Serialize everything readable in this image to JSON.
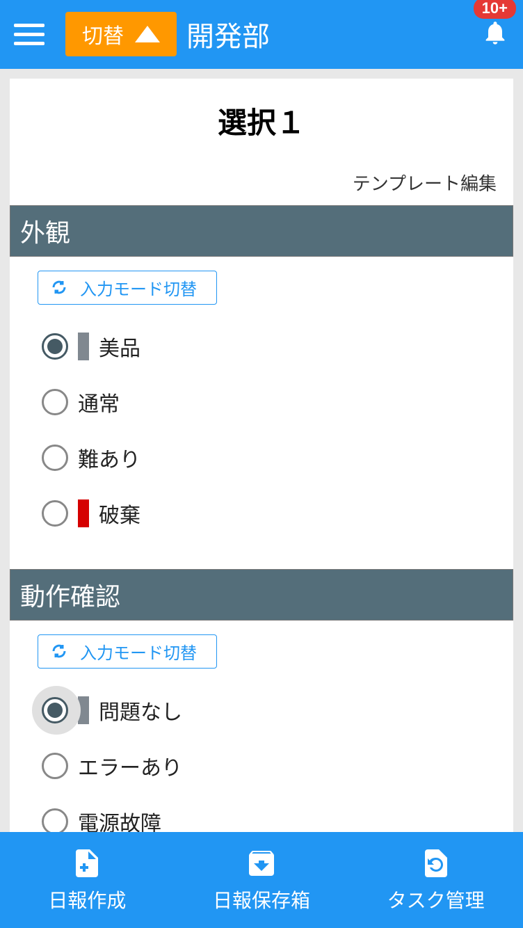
{
  "header": {
    "switch_label": "切替",
    "title": "開発部",
    "badge": "10+"
  },
  "page": {
    "title": "選択１",
    "template_edit": "テンプレート編集"
  },
  "sections": [
    {
      "title": "外観",
      "mode_toggle": "入力モード切替",
      "options": [
        {
          "label": "美品",
          "selected": true,
          "color": "#808890",
          "focus": false
        },
        {
          "label": "通常",
          "selected": false,
          "color": null,
          "focus": false
        },
        {
          "label": "難あり",
          "selected": false,
          "color": null,
          "focus": false
        },
        {
          "label": "破棄",
          "selected": false,
          "color": "#d50000",
          "focus": false
        }
      ]
    },
    {
      "title": "動作確認",
      "mode_toggle": "入力モード切替",
      "options": [
        {
          "label": "問題なし",
          "selected": true,
          "color": "#808890",
          "focus": true
        },
        {
          "label": "エラーあり",
          "selected": false,
          "color": null,
          "focus": false
        },
        {
          "label": "電源故障",
          "selected": false,
          "color": null,
          "focus": false
        }
      ]
    }
  ],
  "bottom_nav": {
    "items": [
      {
        "label": "日報作成"
      },
      {
        "label": "日報保存箱"
      },
      {
        "label": "タスク管理"
      }
    ]
  }
}
